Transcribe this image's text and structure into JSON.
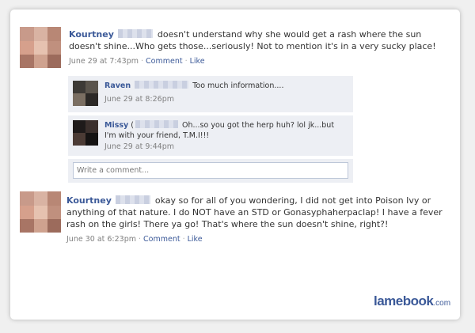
{
  "posts": [
    {
      "author": "Kourtney",
      "text": "doesn't understand why she would get a rash where the sun doesn't shine...Who gets those...seriously! Not to mention it's in a very sucky place!",
      "time": "June 29 at 7:43pm",
      "comment_link": "Comment",
      "like_link": "Like",
      "comments": [
        {
          "author": "Raven",
          "text": "Too much information....",
          "time": "June 29 at 8:26pm"
        },
        {
          "author": "Missy",
          "text": "Oh...so you got the herp huh? lol jk...but I'm with your friend, T.M.I!!!",
          "time": "June 29 at 9:44pm"
        }
      ],
      "write_comment_placeholder": "Write a comment..."
    },
    {
      "author": "Kourtney",
      "text": "okay so for all of you wondering, I did not get into Poison Ivy or anything of that nature. I do NOT have an STD or Gonasyphaherpaclap! I have a fever rash on the girls! There ya go! That's where the sun doesn't shine, right?!",
      "time": "June 30 at 6:23pm",
      "comment_link": "Comment",
      "like_link": "Like"
    }
  ],
  "watermark": {
    "main": "lamebook",
    "suffix": ".com"
  },
  "colors": {
    "link": "#3b5998",
    "comment_bg": "#edeff4",
    "meta": "#808080"
  }
}
